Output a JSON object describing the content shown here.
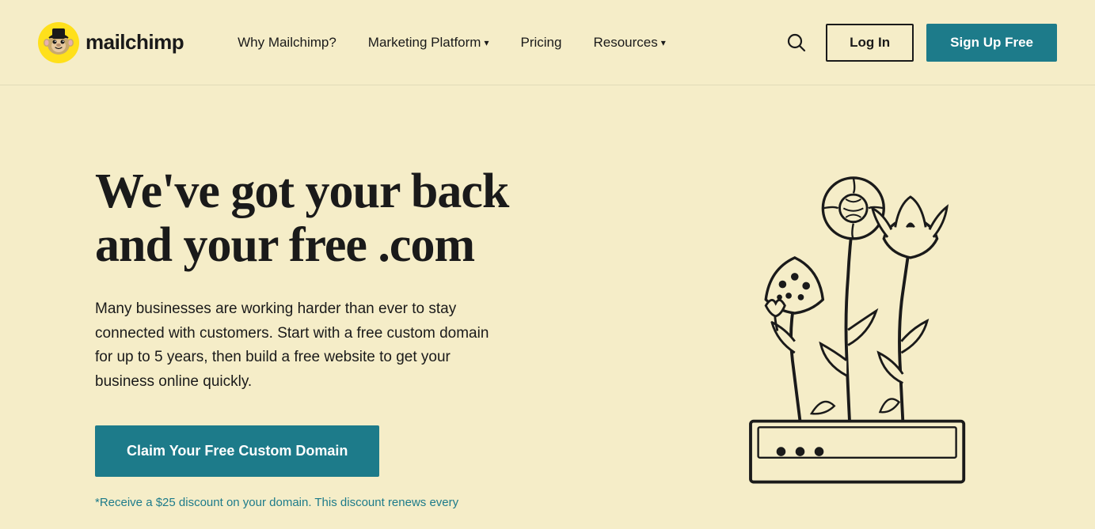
{
  "brand": {
    "name": "mailchimp",
    "logo_alt": "Mailchimp"
  },
  "navbar": {
    "links": [
      {
        "label": "Why Mailchimp?",
        "has_dropdown": false
      },
      {
        "label": "Marketing Platform",
        "has_dropdown": true
      },
      {
        "label": "Pricing",
        "has_dropdown": false
      },
      {
        "label": "Resources",
        "has_dropdown": true
      }
    ],
    "login_label": "Log In",
    "signup_label": "Sign Up Free"
  },
  "hero": {
    "title": "We've got your back and your free .com",
    "description": "Many businesses are working harder than ever to stay connected with customers. Start with a free custom domain for up to 5 years, then build a free website to get your business online quickly.",
    "cta_label": "Claim Your Free Custom Domain",
    "disclaimer": "*Receive a $25 discount on your domain. This discount renews every"
  },
  "colors": {
    "bg": "#f5edc8",
    "teal": "#1d7b8a",
    "dark": "#1a1a1a",
    "white": "#ffffff"
  }
}
